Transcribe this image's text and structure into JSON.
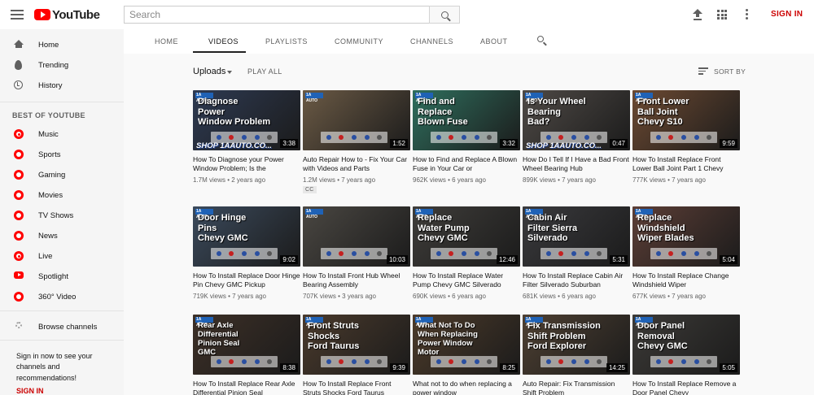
{
  "masthead": {
    "logo_text": "YouTube",
    "search_placeholder": "Search",
    "signin_label": "SIGN IN"
  },
  "sidebar": {
    "primary": [
      {
        "label": "Home",
        "icon": "home-icon"
      },
      {
        "label": "Trending",
        "icon": "flame-icon"
      },
      {
        "label": "History",
        "icon": "history-icon"
      }
    ],
    "section_heading": "BEST OF YOUTUBE",
    "best_of": [
      {
        "label": "Music",
        "icon": "music-icon"
      },
      {
        "label": "Sports",
        "icon": "sports-icon"
      },
      {
        "label": "Gaming",
        "icon": "gaming-icon"
      },
      {
        "label": "Movies",
        "icon": "movies-icon"
      },
      {
        "label": "TV Shows",
        "icon": "tv-shows-icon"
      },
      {
        "label": "News",
        "icon": "news-icon"
      },
      {
        "label": "Live",
        "icon": "live-icon"
      },
      {
        "label": "Spotlight",
        "icon": "spotlight-icon"
      },
      {
        "label": "360° Video",
        "icon": "360-video-icon"
      }
    ],
    "browse_channels": "Browse channels",
    "signin_prompt": "Sign in now to see your channels and recommendations!",
    "signin_link": "SIGN IN"
  },
  "channel_tabs": [
    "HOME",
    "VIDEOS",
    "PLAYLISTS",
    "COMMUNITY",
    "CHANNELS",
    "ABOUT"
  ],
  "active_tab": "VIDEOS",
  "toolbar": {
    "uploads_label": "Uploads",
    "play_all_label": "PLAY ALL",
    "sort_label": "SORT BY"
  },
  "thumb_badge": "1A AUTO",
  "colors": {
    "accent": "#ff0000",
    "signin": "#cc0000",
    "badge_blue": "#1f62b6"
  },
  "videos": [
    {
      "title": "How To Diagnose your Power Window Problem; Is the",
      "meta": "1.7M views • 2 years ago",
      "duration": "3:38",
      "thumb_text": "Diagnose\nPower\nWindow Problem",
      "thumb_link": "SHOP 1AAUTO.CO...",
      "bg": "#2e3a52"
    },
    {
      "title": "Auto Repair How to - Fix Your Car with Videos and Parts",
      "meta": "1.2M views • 7 years ago",
      "duration": "1:52",
      "cc": "CC",
      "thumb_text": "",
      "bg": "#6b5a45"
    },
    {
      "title": "How to Find and Replace A Blown Fuse in Your Car or",
      "meta": "962K views • 6 years ago",
      "duration": "3:32",
      "thumb_text": "Find and\nReplace\nBlown Fuse",
      "bg": "#2f6f5e"
    },
    {
      "title": "How Do I Tell If I Have a Bad Front Wheel Bearing Hub",
      "meta": "899K views • 7 years ago",
      "duration": "0:47",
      "thumb_text": "Is Your Wheel\nBearing\nBad?",
      "thumb_link": "SHOP 1AAUTO.CO...",
      "bg": "#4f4a46"
    },
    {
      "title": "How To Install Replace Front Lower Ball Joint Part 1 Chevy",
      "meta": "777K views • 7 years ago",
      "duration": "9:59",
      "thumb_text": "Front Lower\nBall Joint\nChevy S10",
      "bg": "#6d4a32"
    },
    {
      "title": "How To Install Replace Door Hinge Pin Chevy GMC Pickup",
      "meta": "719K views • 7 years ago",
      "duration": "9:02",
      "thumb_text": "Door Hinge\nPins\nChevy GMC",
      "bg": "#3b4a5c"
    },
    {
      "title": "How To Install Front Hub Wheel Bearing Assembly",
      "meta": "707K views • 3 years ago",
      "duration": "10:03",
      "thumb_text": "",
      "bg": "#4a4742"
    },
    {
      "title": "How To Install Replace Water Pump Chevy GMC Silverado",
      "meta": "690K views • 6 years ago",
      "duration": "12:46",
      "thumb_text": "Replace\nWater Pump\nChevy GMC",
      "bg": "#3f3d3a"
    },
    {
      "title": "How To Install Replace Cabin Air Filter Silverado Suburban",
      "meta": "681K views • 6 years ago",
      "duration": "5:31",
      "thumb_text": "Cabin Air\nFilter Sierra\nSilverado",
      "bg": "#3a3a3d"
    },
    {
      "title": "How To Install Replace Change Windshield Wiper",
      "meta": "677K views • 7 years ago",
      "duration": "5:04",
      "thumb_text": "Replace\nWindshield\nWiper Blades",
      "bg": "#5c3e36"
    },
    {
      "title": "How To Install Replace Rear Axle Differential Pinion Seal",
      "meta": "",
      "duration": "8:38",
      "thumb_text": "Rear Axle\nDifferential\nPinion Seal\nGMC",
      "bg": "#3d3027"
    },
    {
      "title": "How To Install Replace Front Struts Shocks Ford Taurus",
      "meta": "",
      "duration": "9:39",
      "thumb_text": "Front Struts\nShocks\nFord Taurus",
      "bg": "#4a3a2c"
    },
    {
      "title": "What not to do when replacing a power window",
      "meta": "",
      "duration": "8:25",
      "thumb_text": "What Not To Do\nWhen Replacing\nPower Window\nMotor",
      "bg": "#4d3b2a"
    },
    {
      "title": "Auto Repair: Fix Transmission Shift Problem",
      "meta": "",
      "duration": "14:25",
      "thumb_text": "Fix Transmission\nShift Problem\nFord Explorer",
      "bg": "#4e4032"
    },
    {
      "title": "How To Install Replace Remove a Door Panel Chevy",
      "meta": "",
      "duration": "5:05",
      "thumb_text": "Door Panel\nRemoval\nChevy GMC",
      "bg": "#3c3a37"
    }
  ]
}
